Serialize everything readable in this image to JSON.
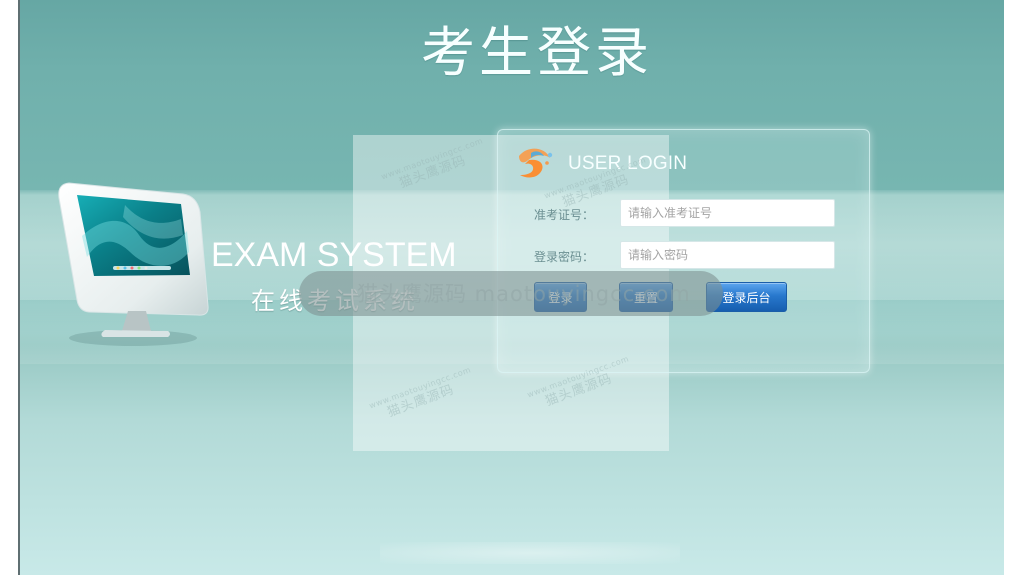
{
  "page": {
    "title": "考生登录"
  },
  "system": {
    "title": "EXAM SYSTEM",
    "subtitle": "在线考试系统"
  },
  "login": {
    "heading": "USER LOGIN",
    "exam_id_label": "准考证号：",
    "exam_id_placeholder": "请输入准考证号",
    "password_label": "登录密码：",
    "password_placeholder": "请输入密码",
    "buttons": {
      "login": "登录",
      "reset": "重置",
      "admin": "登录后台"
    }
  },
  "icons": {
    "computer": "computer-icon",
    "login_logo": "exam-logo-icon"
  },
  "colors": {
    "background_teal": "#70b0ac",
    "button_blue": "#2878cd",
    "title_white": "#f7ffff"
  }
}
